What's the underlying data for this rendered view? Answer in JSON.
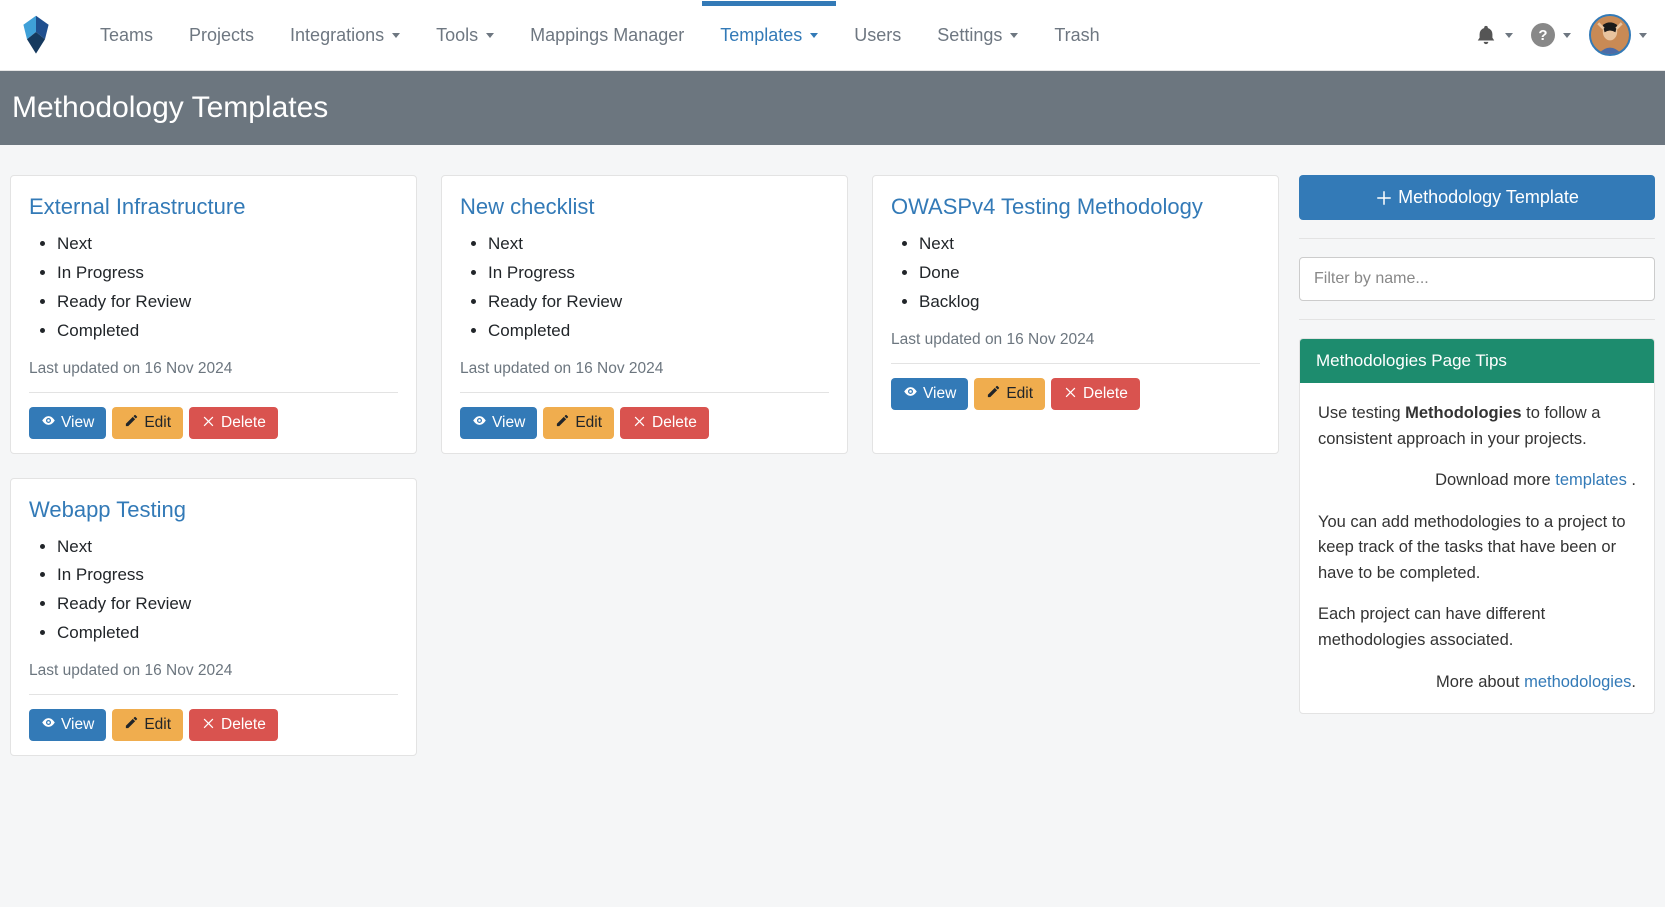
{
  "nav": {
    "items": [
      {
        "label": "Teams",
        "dropdown": false,
        "active": false
      },
      {
        "label": "Projects",
        "dropdown": false,
        "active": false
      },
      {
        "label": "Integrations",
        "dropdown": true,
        "active": false
      },
      {
        "label": "Tools",
        "dropdown": true,
        "active": false
      },
      {
        "label": "Mappings Manager",
        "dropdown": false,
        "active": false
      },
      {
        "label": "Templates",
        "dropdown": true,
        "active": true
      },
      {
        "label": "Users",
        "dropdown": false,
        "active": false
      },
      {
        "label": "Settings",
        "dropdown": true,
        "active": false
      },
      {
        "label": "Trash",
        "dropdown": false,
        "active": false
      }
    ]
  },
  "page_title": "Methodology Templates",
  "cards": [
    {
      "title": "External Infrastructure",
      "items": [
        "Next",
        "In Progress",
        "Ready for Review",
        "Completed"
      ],
      "meta": "Last updated on 16 Nov 2024"
    },
    {
      "title": "New checklist",
      "items": [
        "Next",
        "In Progress",
        "Ready for Review",
        "Completed"
      ],
      "meta": "Last updated on 16 Nov 2024"
    },
    {
      "title": "OWASPv4 Testing Methodology",
      "items": [
        "Next",
        "Done",
        "Backlog"
      ],
      "meta": "Last updated on 16 Nov 2024"
    },
    {
      "title": "Webapp Testing",
      "items": [
        "Next",
        "In Progress",
        "Ready for Review",
        "Completed"
      ],
      "meta": "Last updated on 16 Nov 2024"
    }
  ],
  "actions": {
    "view": "View",
    "edit": "Edit",
    "delete": "Delete"
  },
  "sidebar": {
    "add_button": "Methodology Template",
    "filter_placeholder": "Filter by name...",
    "tips_header": "Methodologies Page Tips",
    "tips_p1_a": "Use testing ",
    "tips_p1_strong": "Methodologies",
    "tips_p1_b": " to follow a consistent approach in your projects.",
    "tips_download_prefix": "Download more ",
    "tips_download_link": "templates",
    "tips_download_suffix": " .",
    "tips_p2": "You can add methodologies to a project to keep track of the tasks that have been or have to be completed.",
    "tips_p3": "Each project can have different methodologies associated.",
    "tips_more_prefix": "More about ",
    "tips_more_link": "methodologies",
    "tips_more_suffix": "."
  }
}
